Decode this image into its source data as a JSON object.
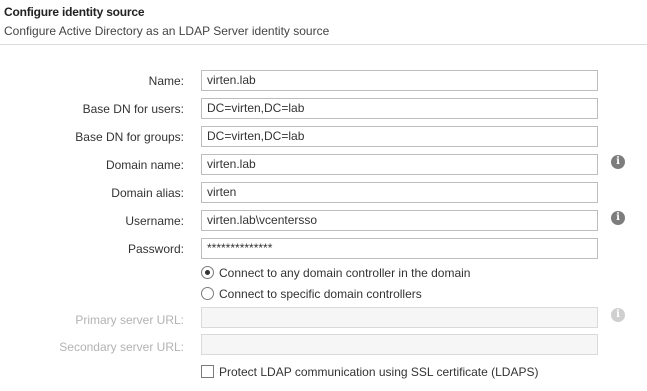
{
  "header": {
    "title": "Configure identity source",
    "subtitle": "Configure Active Directory as an LDAP Server identity source"
  },
  "form": {
    "name": {
      "label": "Name:",
      "value": "virten.lab"
    },
    "base_dn_users": {
      "label": "Base DN for users:",
      "value": "DC=virten,DC=lab"
    },
    "base_dn_groups": {
      "label": "Base DN for groups:",
      "value": "DC=virten,DC=lab"
    },
    "domain_name": {
      "label": "Domain name:",
      "value": "virten.lab",
      "icon": "info-icon"
    },
    "domain_alias": {
      "label": "Domain alias:",
      "value": "virten"
    },
    "username": {
      "label": "Username:",
      "value": "virten.lab\\vcentersso",
      "icon": "info-icon"
    },
    "password": {
      "label": "Password:",
      "value": "**************"
    },
    "connect_any": {
      "label": "Connect to any domain controller in the domain",
      "selected": true
    },
    "connect_specific": {
      "label": "Connect to specific domain controllers",
      "selected": false
    },
    "primary_url": {
      "label": "Primary server URL:",
      "value": "",
      "disabled": true,
      "icon": "info-icon"
    },
    "secondary_url": {
      "label": "Secondary server URL:",
      "value": "",
      "disabled": true
    },
    "ldaps": {
      "label": "Protect LDAP communication using SSL certificate (LDAPS)",
      "checked": false
    }
  }
}
